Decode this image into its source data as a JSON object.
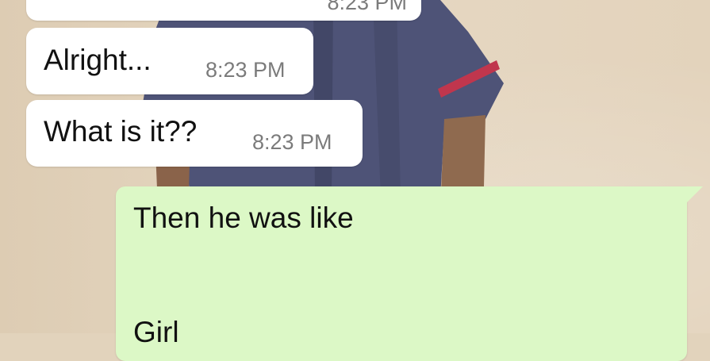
{
  "chat": {
    "messages": [
      {
        "direction": "incoming",
        "text": "",
        "time": "8:23 PM"
      },
      {
        "direction": "incoming",
        "text": "Alright...",
        "time": "8:23 PM"
      },
      {
        "direction": "incoming",
        "text": "What is it??",
        "time": "8:23 PM"
      },
      {
        "direction": "outgoing",
        "text": "Then he was like",
        "text_continued": "Girl"
      }
    ]
  },
  "colors": {
    "incoming_bubble": "#ffffff",
    "outgoing_bubble": "#dcf8c6",
    "timestamp": "#7b7b7b",
    "wallpaper": "#e2d3bc",
    "shirt": "#4e5377",
    "shirt_stripe": "#c0364d"
  }
}
